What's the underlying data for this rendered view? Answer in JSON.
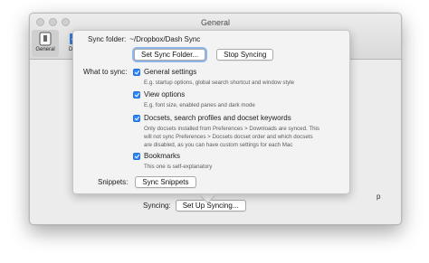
{
  "window": {
    "title": "General",
    "toolbar": [
      {
        "label": "General",
        "icon": "general-icon",
        "active": true
      },
      {
        "label": "Dow",
        "icon": "downloads-icon",
        "active": false
      }
    ]
  },
  "popover": {
    "sync_folder": {
      "label": "Sync folder:",
      "path": "~/Dropbox/Dash Sync",
      "set_button": "Set Sync Folder...",
      "stop_button": "Stop Syncing"
    },
    "what_to_sync_label": "What to sync:",
    "options": [
      {
        "label": "General settings",
        "checked": true,
        "desc": "E.g. startup options, global search shortcut and window style"
      },
      {
        "label": "View options",
        "checked": true,
        "desc": "E.g. font size, enabled panes and dark mode"
      },
      {
        "label": "Docsets, search profiles and docset keywords",
        "checked": true,
        "desc_line1": "Only docsets installed from Preferences > Downloads are synced. This",
        "desc_line2": "will not sync Preferences > Docsets docset order and which docsets",
        "desc_line3": "are disabled, as you can have custom settings for each Mac"
      },
      {
        "label": "Bookmarks",
        "checked": true,
        "desc": "This one is self-explanatory"
      }
    ],
    "snippets": {
      "label": "Snippets:",
      "button": "Sync Snippets"
    }
  },
  "bottom": {
    "syncing_label": "Syncing:",
    "setup_button": "Set Up Syncing...",
    "edge_fragment": "p"
  },
  "colors": {
    "checkbox": "#2f86ff",
    "focus_ring": "#8fb6ea"
  }
}
